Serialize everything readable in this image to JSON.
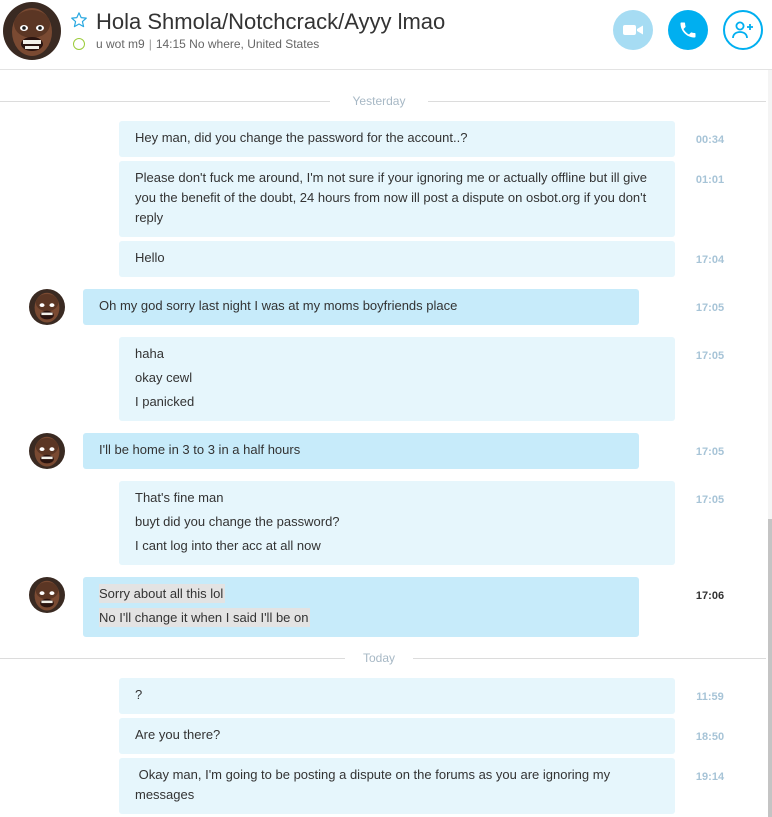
{
  "header": {
    "title": "Hola Shmola/Notchcrack/Ayyy lmao",
    "mood": "u wot m9",
    "separator": "|",
    "local_time_location": "14:15 No where, United States",
    "icons": {
      "favorite": "star-outline-icon",
      "status": "online-status-icon",
      "video": "video-camera-icon",
      "call": "phone-icon",
      "add": "add-contact-icon"
    },
    "accent_color": "#00aff0"
  },
  "days": [
    {
      "label": "Yesterday"
    },
    {
      "label": "Today"
    }
  ],
  "messages": [
    {
      "sender": "me",
      "lines": [
        "Hey man, did you change the password for the account..?"
      ],
      "time": "00:34"
    },
    {
      "sender": "me",
      "lines": [
        "Please don't fuck me around, I'm not sure if your ignoring me or actually offline but ill give you the benefit of the doubt, 24 hours from now ill post a dispute on osbot.org if you don't reply"
      ],
      "time": "01:01"
    },
    {
      "sender": "me",
      "lines": [
        "Hello"
      ],
      "time": "17:04"
    },
    {
      "sender": "them",
      "lines": [
        "Oh my god sorry last night I was at my moms boyfriends place"
      ],
      "time": "17:05"
    },
    {
      "sender": "me",
      "lines": [
        "haha",
        "okay cewl",
        "I panicked"
      ],
      "time": "17:05"
    },
    {
      "sender": "them",
      "lines": [
        "I'll be home in 3 to 3 in a half hours"
      ],
      "time": "17:05"
    },
    {
      "sender": "me",
      "lines": [
        "That's fine man",
        "buyt did you change the password?",
        "I cant log into ther acc at all now"
      ],
      "time": "17:05"
    },
    {
      "sender": "them",
      "lines": [
        "Sorry about all this lol",
        "No I'll change it when I said I'll be on"
      ],
      "time": "17:06"
    },
    {
      "sender": "me",
      "lines": [
        "?"
      ],
      "time": "11:59"
    },
    {
      "sender": "me",
      "lines": [
        "Are you there?"
      ],
      "time": "18:50"
    },
    {
      "sender": "me",
      "lines": [
        " Okay man, I'm going to be posting a dispute on the forums as you are ignoring my messages"
      ],
      "time": "19:14"
    }
  ],
  "colors": {
    "my_bubble": "#e6f6fc",
    "their_bubble": "#c7ebfa",
    "timestamp": "#a7c4d7",
    "status_online": "#9ccc3c"
  }
}
